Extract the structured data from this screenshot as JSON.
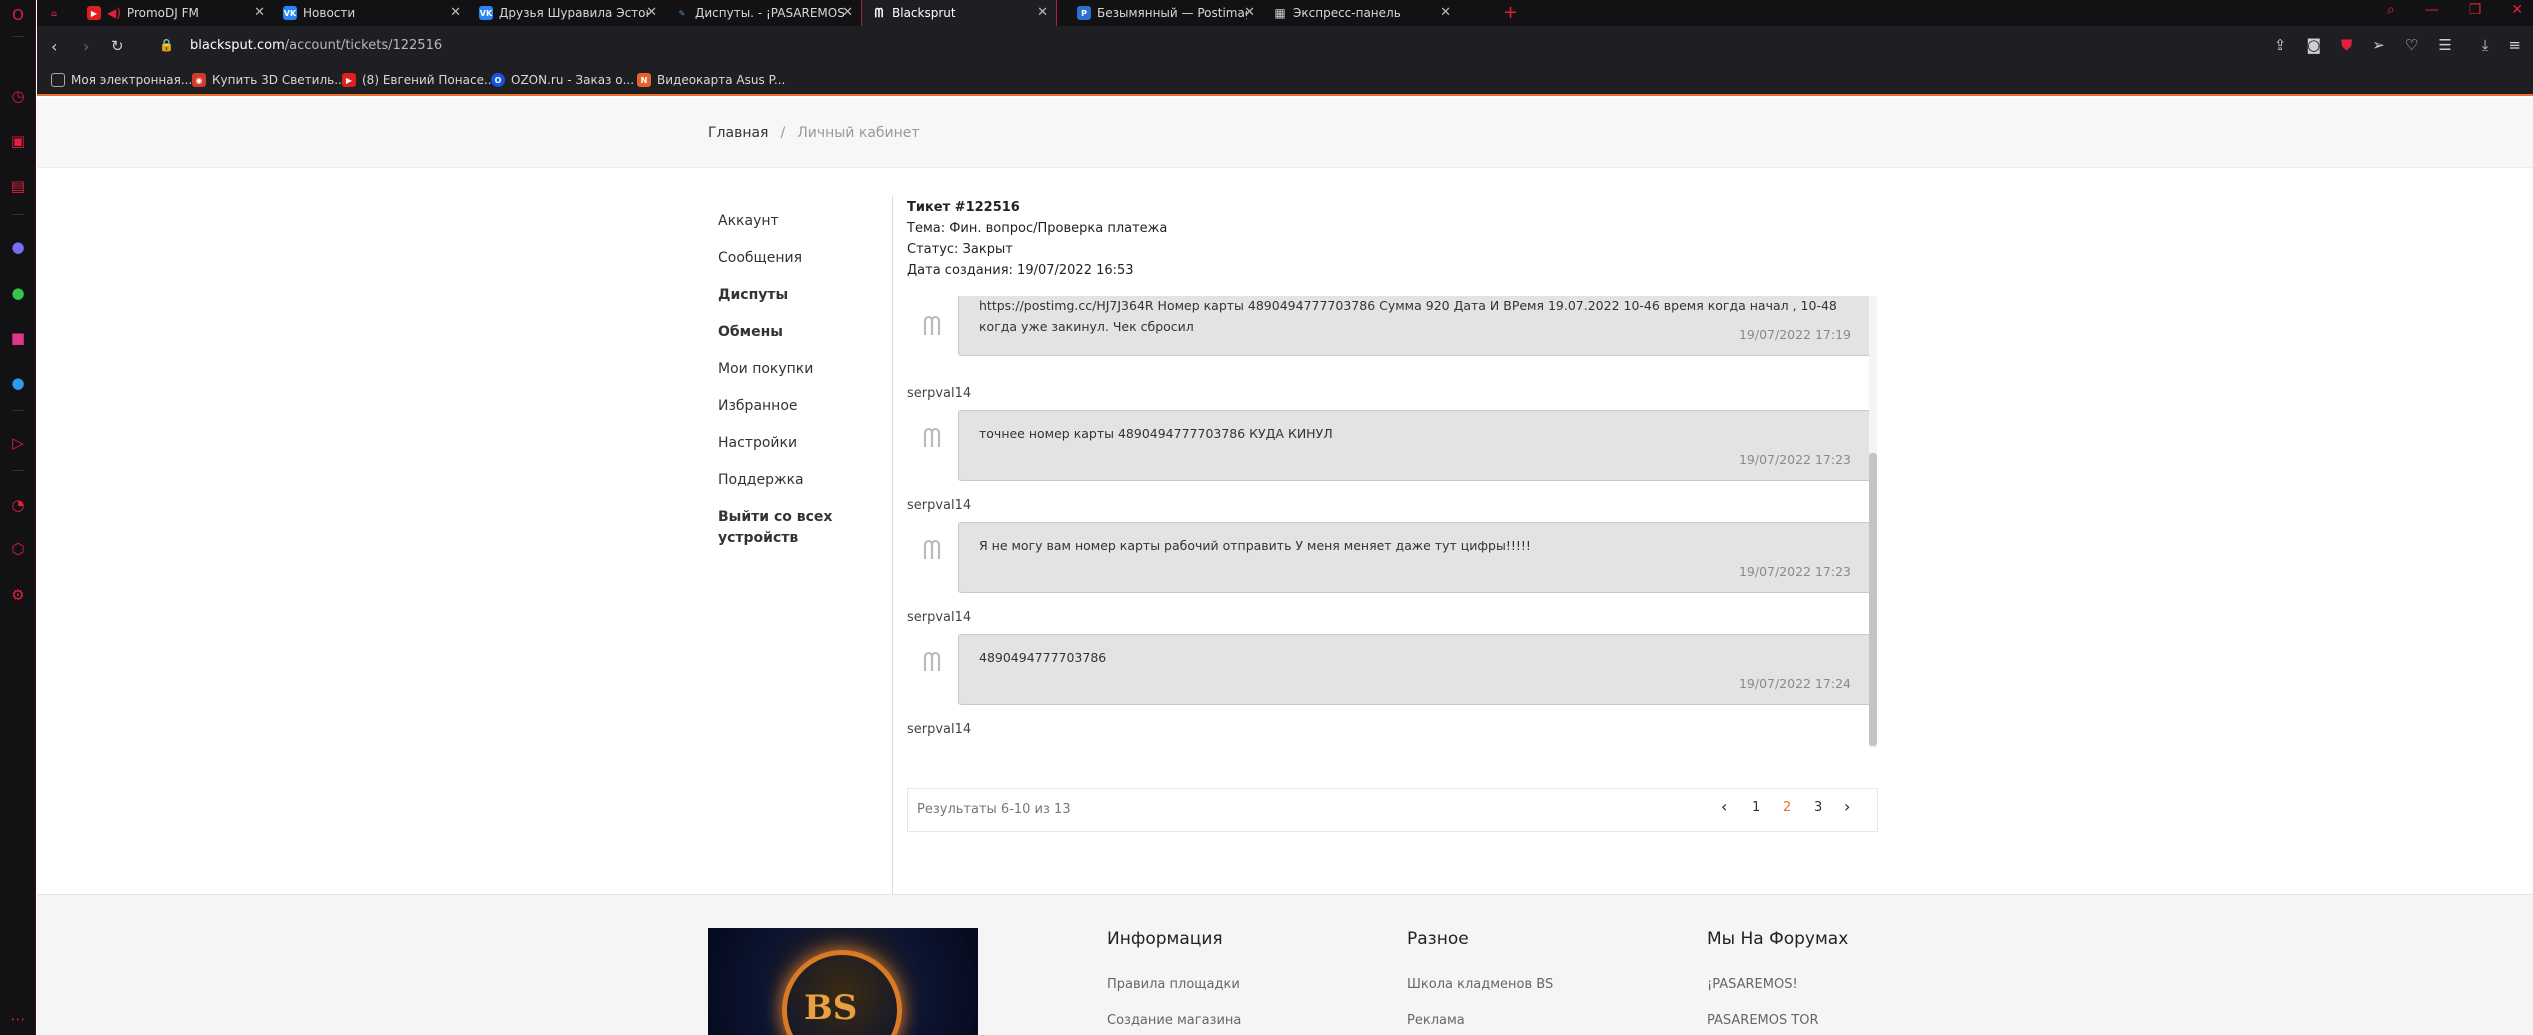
{
  "browser": {
    "tabs": [
      {
        "title": "PromoDJ FM",
        "icon": "youtube-icon",
        "color": "#e02020"
      },
      {
        "title": "Новости",
        "icon": "vk-icon",
        "color": "#2787f5"
      },
      {
        "title": "Друзья Шуравила Эстонс",
        "icon": "vk-icon",
        "color": "#2787f5"
      },
      {
        "title": "Диспуты. - ¡PASAREMOS!",
        "icon": "feather-icon",
        "color": "#5b8fd8"
      },
      {
        "title": "Blacksprut",
        "icon": "blacksprut-icon",
        "color": "#ffffff"
      },
      {
        "title": "Безымянный — Postimag",
        "icon": "postimages-icon",
        "color": "#2c6fd1"
      },
      {
        "title": "Экспресс-панель",
        "icon": "grid-icon",
        "color": "#bbbbbb"
      }
    ],
    "url_host": "blacksput.com",
    "url_path": "/account/tickets/122516",
    "bookmarks": [
      {
        "title": "Моя электронная...",
        "icon": "folder-icon",
        "color": "#555555"
      },
      {
        "title": "Купить 3D Светиль...",
        "icon": "bookmark-site-icon",
        "color": "#d23b2c"
      },
      {
        "title": "(8) Евгений Понасе...",
        "icon": "youtube-icon",
        "color": "#e02020"
      },
      {
        "title": "OZON.ru - Заказ о...",
        "icon": "ozon-icon",
        "color": "#1656d9"
      },
      {
        "title": "Видеокарта Asus P...",
        "icon": "dns-icon",
        "color": "#e8632a"
      }
    ]
  },
  "breadcrumb": {
    "home": "Главная",
    "separator": "/",
    "current": "Личный кабинет"
  },
  "menu": [
    {
      "label": "Аккаунт",
      "bold": false
    },
    {
      "label": "Сообщения",
      "bold": false
    },
    {
      "label": "Диспуты",
      "bold": true
    },
    {
      "label": "Обмены",
      "bold": true
    },
    {
      "label": "Мои покупки",
      "bold": false
    },
    {
      "label": "Избранное",
      "bold": false
    },
    {
      "label": "Настройки",
      "bold": false
    },
    {
      "label": "Поддержка",
      "bold": false
    },
    {
      "label": "Выйти со всех устройств",
      "bold": true
    }
  ],
  "ticket": {
    "title": "Тикет #122516",
    "subject": "Тема: Фин. вопрос/Проверка платежа",
    "status": "Статус: Закрыт",
    "created": "Дата создания: 19/07/2022 16:53"
  },
  "messages": [
    {
      "text": "https://postimg.cc/HJ7J364R Номер карты 4890494777703786 Сумма 920 Дата И ВРемя 19.07.2022 10-46 время когда начал , 10-48 когда уже закинул. Чек сбросил",
      "time": "19/07/2022 17:19",
      "author": "serpval14"
    },
    {
      "text": "точнее номер карты 4890494777703786 КУДА КИНУЛ",
      "time": "19/07/2022 17:23",
      "author": "serpval14"
    },
    {
      "text": "Я не могу вам номер карты рабочий отправить У меня меняет даже тут цифры!!!!!",
      "time": "19/07/2022 17:23",
      "author": "serpval14"
    },
    {
      "text": "4890494777703786",
      "time": "19/07/2022 17:24",
      "author": "serpval14"
    }
  ],
  "pagination": {
    "results_text": "Результаты 6-10 из 13",
    "prev": "‹",
    "next": "›",
    "pages": [
      "1",
      "2",
      "3"
    ],
    "current_page": "2"
  },
  "footer": {
    "logo_text": "BS",
    "columns": [
      {
        "title": "Информация",
        "links": [
          "Правила площадки",
          "Создание магазина"
        ]
      },
      {
        "title": "Разное",
        "links": [
          "Школа кладменов BS",
          "Реклама"
        ]
      },
      {
        "title": "Мы На Форумах",
        "links": [
          "¡PASAREMOS!",
          "PASAREMOS TOR"
        ]
      }
    ]
  },
  "colors": {
    "accent": "#e8722a",
    "browser_accent": "#e0203c",
    "bubble_bg": "#e2e3e5"
  }
}
